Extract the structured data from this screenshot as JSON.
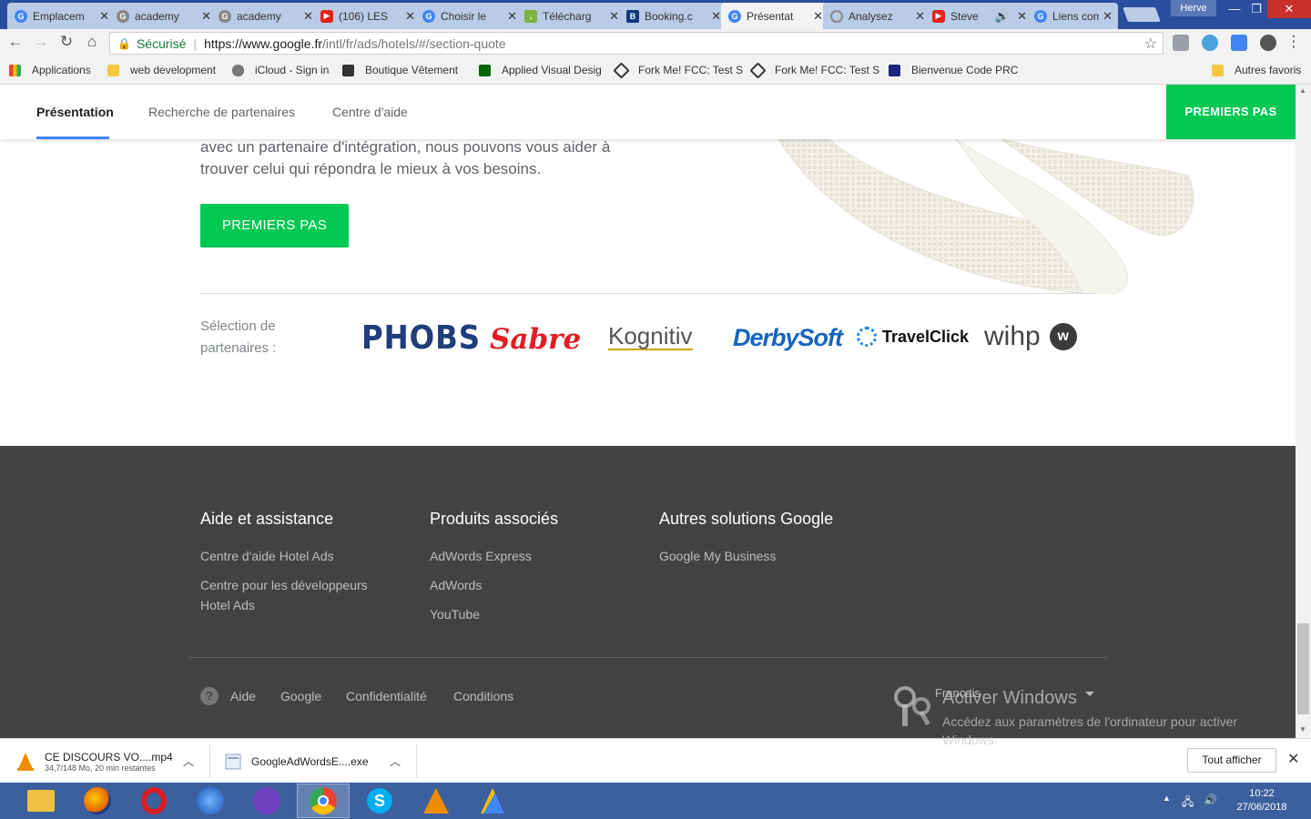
{
  "browser": {
    "tabs": [
      {
        "title": "Emplacem",
        "favicon": "google-icon",
        "active": false
      },
      {
        "title": "academy",
        "favicon": "google-icon",
        "active": false
      },
      {
        "title": "academy",
        "favicon": "google-icon",
        "active": false
      },
      {
        "title": "(106) LES",
        "favicon": "youtube-icon",
        "active": false
      },
      {
        "title": "Choisir le",
        "favicon": "google-icon",
        "active": false
      },
      {
        "title": "Télécharg",
        "favicon": "download-icon",
        "active": false
      },
      {
        "title": "Booking.c",
        "favicon": "booking-icon",
        "active": false
      },
      {
        "title": "Présentat",
        "favicon": "google-icon",
        "active": true
      },
      {
        "title": "Analysez",
        "favicon": "loading-icon",
        "active": false
      },
      {
        "title": "Steve",
        "favicon": "youtube-icon",
        "active": false
      },
      {
        "title": "Liens com",
        "favicon": "google-icon",
        "active": false
      }
    ],
    "user_name": "Herve",
    "secure_label": "Sécurisé",
    "url_host": "https://www.google.fr",
    "url_path": "/intl/fr/ads/hotels/#/section-quote",
    "bookmarks": [
      {
        "label": "Applications",
        "icon": "apps-icon"
      },
      {
        "label": "web development",
        "icon": "folder-icon"
      },
      {
        "label": "iCloud - Sign in",
        "icon": "apple-icon"
      },
      {
        "label": "Boutique Vêtement",
        "icon": "shop-icon"
      },
      {
        "label": "Applied Visual Desig",
        "icon": "fcc-icon"
      },
      {
        "label": "Fork Me! FCC: Test S",
        "icon": "codepen-icon"
      },
      {
        "label": "Fork Me! FCC: Test S",
        "icon": "codepen-icon"
      },
      {
        "label": "Bienvenue Code PRC",
        "icon": "code-icon"
      },
      {
        "label": "Autres favoris",
        "icon": "folder-icon"
      }
    ]
  },
  "subnav": {
    "links": [
      "Présentation",
      "Recherche de partenaires",
      "Centre d'aide"
    ],
    "cta": "PREMIERS PAS"
  },
  "hero": {
    "text_line1": "avec un partenaire d'intégration, nous pouvons vous aider à",
    "text_line2": "trouver celui qui répondra le mieux à vos besoins.",
    "cta": "PREMIERS PAS"
  },
  "partners": {
    "label_line1": "Sélection de",
    "label_line2": "partenaires :",
    "logos": [
      "PHOBS",
      "Sabre",
      "Kognitiv",
      "DerbySoft",
      "TravelClick",
      "wihp"
    ]
  },
  "footer": {
    "columns": [
      {
        "title": "Aide et assistance",
        "links": [
          "Centre d'aide Hotel Ads",
          "Centre pour les développeurs Hotel Ads"
        ]
      },
      {
        "title": "Produits associés",
        "links": [
          "AdWords Express",
          "AdWords",
          "YouTube"
        ]
      },
      {
        "title": "Autres solutions Google",
        "links": [
          "Google My Business"
        ]
      }
    ],
    "bottom_links": [
      "Aide",
      "Google",
      "Confidentialité",
      "Conditions"
    ],
    "language": "Français"
  },
  "watermark": {
    "title": "Activer Windows",
    "subtitle": "Accédez aux paramètres de l'ordinateur pour activer Windows."
  },
  "downloads": [
    {
      "name": "CE DISCOURS VO....mp4",
      "status": "34,7/148 Mo, 20 min restantes"
    },
    {
      "name": "GoogleAdWordsE....exe",
      "status": ""
    }
  ],
  "download_show_all": "Tout afficher",
  "taskbar": {
    "time": "10:22",
    "date": "27/06/2018"
  },
  "colors": {
    "accent_green": "#00c853",
    "footer_bg": "#424242",
    "tab_active_underline": "#4285f4"
  }
}
